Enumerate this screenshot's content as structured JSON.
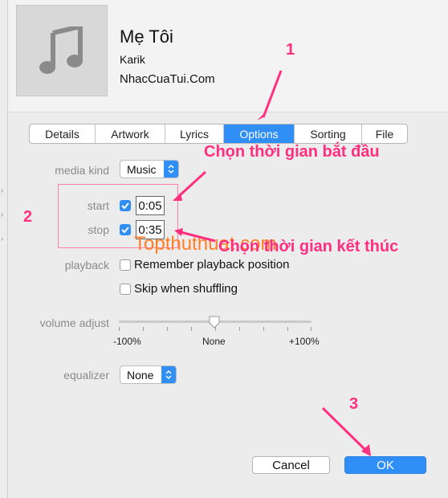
{
  "song": {
    "title": "Mẹ Tôi",
    "artist": "Karik",
    "album": "NhacCuaTui.Com"
  },
  "tabs": [
    {
      "label": "Details",
      "active": false
    },
    {
      "label": "Artwork",
      "active": false
    },
    {
      "label": "Lyrics",
      "active": false
    },
    {
      "label": "Options",
      "active": true
    },
    {
      "label": "Sorting",
      "active": false
    },
    {
      "label": "File",
      "active": false
    }
  ],
  "options": {
    "media_kind": {
      "label": "media kind",
      "value": "Music"
    },
    "start": {
      "label": "start",
      "checked": true,
      "value": "0:05"
    },
    "stop": {
      "label": "stop",
      "checked": true,
      "value": "0:35"
    },
    "playback": {
      "label": "playback",
      "remember": {
        "label": "Remember playback position",
        "checked": false
      },
      "skip": {
        "label": "Skip when shuffling",
        "checked": false
      }
    },
    "volume": {
      "label": "volume adjust",
      "min_label": "-100%",
      "mid_label": "None",
      "max_label": "+100%",
      "value_percent": 0
    },
    "equalizer": {
      "label": "equalizer",
      "value": "None"
    }
  },
  "buttons": {
    "cancel": "Cancel",
    "ok": "OK"
  },
  "annotations": {
    "n1": "1",
    "n2": "2",
    "n3": "3",
    "start_hint": "Chọn thời gian bắt đầu",
    "stop_hint": "Chọn thời gian kết thúc",
    "watermark": "Topthuthuat.com"
  },
  "colors": {
    "accent": "#2f8ff7",
    "annotation": "#ff2f80",
    "watermark": "#ff7f27"
  }
}
